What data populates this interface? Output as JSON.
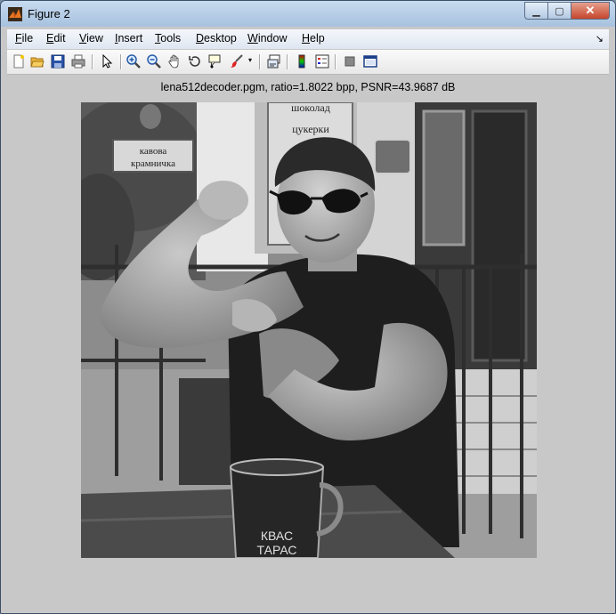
{
  "window": {
    "title": "Figure 2"
  },
  "menu": {
    "items": [
      {
        "label": "File",
        "accel": "F",
        "rest": "ile"
      },
      {
        "label": "Edit",
        "accel": "E",
        "rest": "dit"
      },
      {
        "label": "View",
        "accel": "V",
        "rest": "iew"
      },
      {
        "label": "Insert",
        "accel": "I",
        "rest": "nsert"
      },
      {
        "label": "Tools",
        "accel": "T",
        "rest": "ools"
      },
      {
        "label": "Desktop",
        "accel": "D",
        "rest": "esktop"
      },
      {
        "label": "Window",
        "accel": "W",
        "rest": "indow"
      },
      {
        "label": "Help",
        "accel": "H",
        "rest": "elp"
      }
    ]
  },
  "toolbar": {
    "icons": [
      "new-figure-icon",
      "open-file-icon",
      "save-icon",
      "print-icon",
      "edit-plot-icon",
      "zoom-in-icon",
      "zoom-out-icon",
      "pan-icon",
      "rotate-3d-icon",
      "data-cursor-icon",
      "brush-icon",
      "link-plot-icon",
      "colorbar-icon",
      "legend-icon",
      "hide-plot-tools-icon",
      "show-plot-tools-icon"
    ]
  },
  "axes": {
    "title": "lena512decoder.pgm, ratio=1.8022 bpp, PSNR=43.9687 dB"
  },
  "photo": {
    "signs": {
      "top_sign_line1": "шоколад",
      "top_sign_line2": "цукерки",
      "left_sign_line1": "кавова",
      "left_sign_line2": "крамничка"
    },
    "mug_label_line1": "КВАС",
    "mug_label_line2": "ТАРАС"
  },
  "colors": {
    "accent_close": "#c6452c",
    "figure_bg": "#c8c8c8"
  }
}
